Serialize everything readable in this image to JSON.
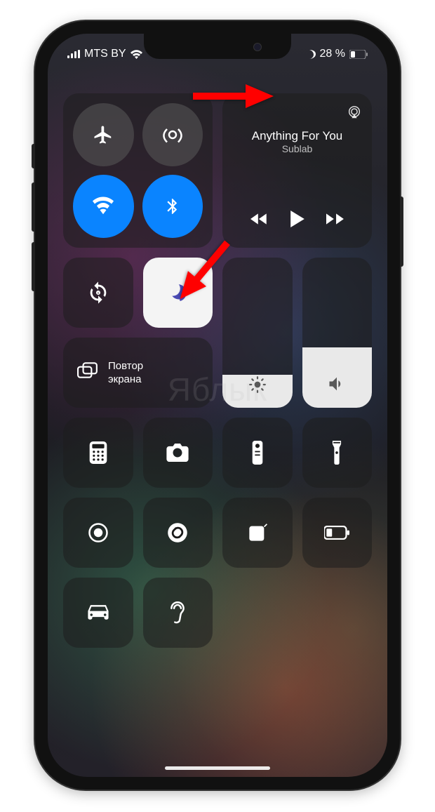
{
  "statusbar": {
    "carrier": "MTS BY",
    "battery_percent": "28 %"
  },
  "media": {
    "title": "Anything For You",
    "artist": "Sublab"
  },
  "screen_mirror": {
    "label": "Повтор\nэкрана"
  },
  "watermark": "Яблык",
  "icons": {
    "signal": "signal-icon",
    "wifi": "wifi-icon",
    "moon": "moon-icon",
    "battery": "battery-icon",
    "airplane": "airplane-icon",
    "cellular": "cellular-antenna-icon",
    "bluetooth": "bluetooth-icon",
    "airplay": "airplay-icon",
    "rewind": "rewind-icon",
    "play": "play-icon",
    "forward": "forward-icon",
    "lock_rotation": "rotation-lock-icon",
    "dnd": "moon-icon",
    "mirror": "screen-mirror-icon",
    "brightness": "sun-icon",
    "volume": "volume-icon",
    "calculator": "calculator-icon",
    "camera": "camera-icon",
    "remote": "remote-icon",
    "flashlight": "flashlight-icon",
    "record": "record-icon",
    "shazam": "shazam-icon",
    "notes": "note-icon",
    "low_power": "low-power-icon",
    "car": "car-icon",
    "hearing": "ear-icon"
  }
}
